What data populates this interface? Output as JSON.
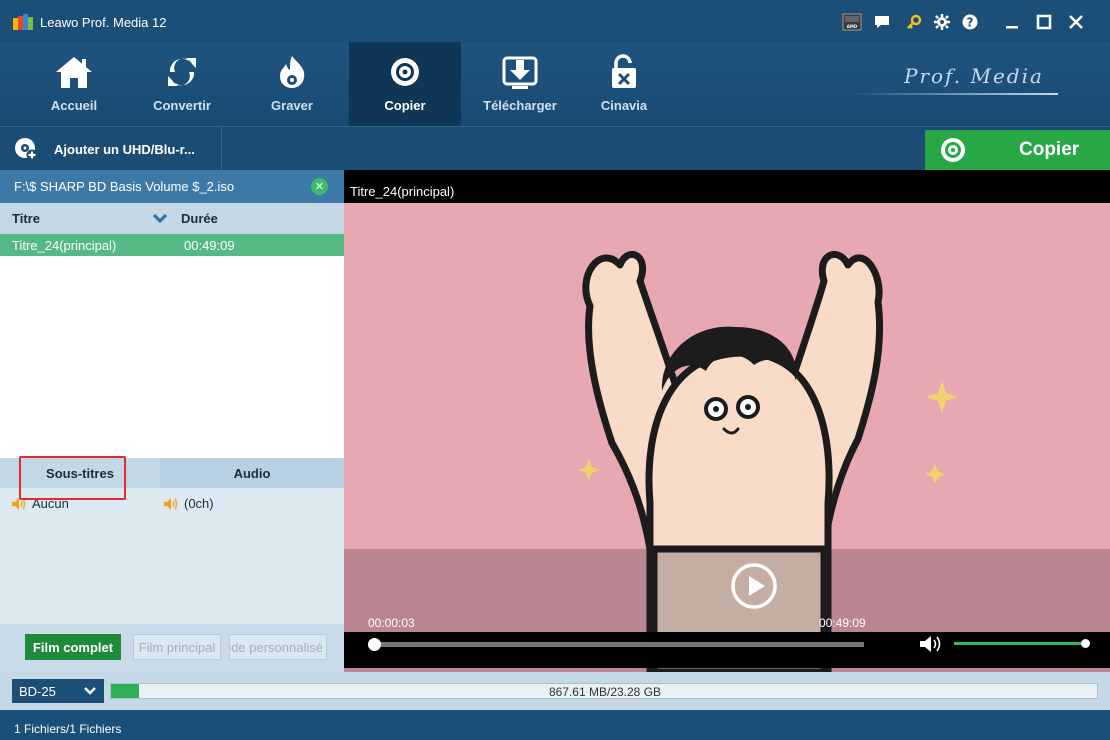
{
  "window": {
    "title": "Leawo Prof. Media 12",
    "title_icons": [
      "amd-icon",
      "chat-icon",
      "key-icon",
      "gear-icon",
      "help-icon",
      "minimize-icon",
      "maximize-icon",
      "close-icon"
    ]
  },
  "nav": {
    "items": [
      {
        "label": "Accueil",
        "icon": "home-icon"
      },
      {
        "label": "Convertir",
        "icon": "convert-icon"
      },
      {
        "label": "Graver",
        "icon": "burn-icon"
      },
      {
        "label": "Copier",
        "icon": "copy-disc-icon",
        "active": true
      },
      {
        "label": "Télécharger",
        "icon": "download-icon"
      },
      {
        "label": "Cinavia",
        "icon": "unlock-icon"
      }
    ],
    "brand": "Prof. Media"
  },
  "toolbar": {
    "add_label": "Ajouter un UHD/Blu-r...",
    "copy_label": "Copier"
  },
  "left": {
    "file_name": "F:\\$ SHARP BD Basis Volume $_2.iso",
    "columns": {
      "title": "Titre",
      "duration": "Durée"
    },
    "titles": [
      {
        "title": "Titre_24(principal)",
        "duration": "00:49:09",
        "selected": true
      }
    ],
    "subtitle_header": "Sous-titres",
    "audio_header": "Audio",
    "subtitle_value": "Aucun",
    "audio_value": "(0ch)",
    "modes": {
      "full": "Film complet",
      "main": "Film principal",
      "custom": "Mode personnalisé"
    }
  },
  "video": {
    "title": "Titre_24(principal)",
    "current_time": "00:00:03",
    "total_time": "00:49:09",
    "progress": 0.001,
    "volume": 0.95
  },
  "bottom": {
    "disc_type": "BD-25",
    "capacity_label": "867.61 MB/23.28 GB",
    "capacity_fraction": 0.036,
    "status": "1 Fichiers/1 Fichiers"
  },
  "colors": {
    "accent_green": "#27a745",
    "nav_blue": "#1c4f78",
    "video_bg": "#e7a8b2",
    "highlight_red": "#e32b2b"
  }
}
